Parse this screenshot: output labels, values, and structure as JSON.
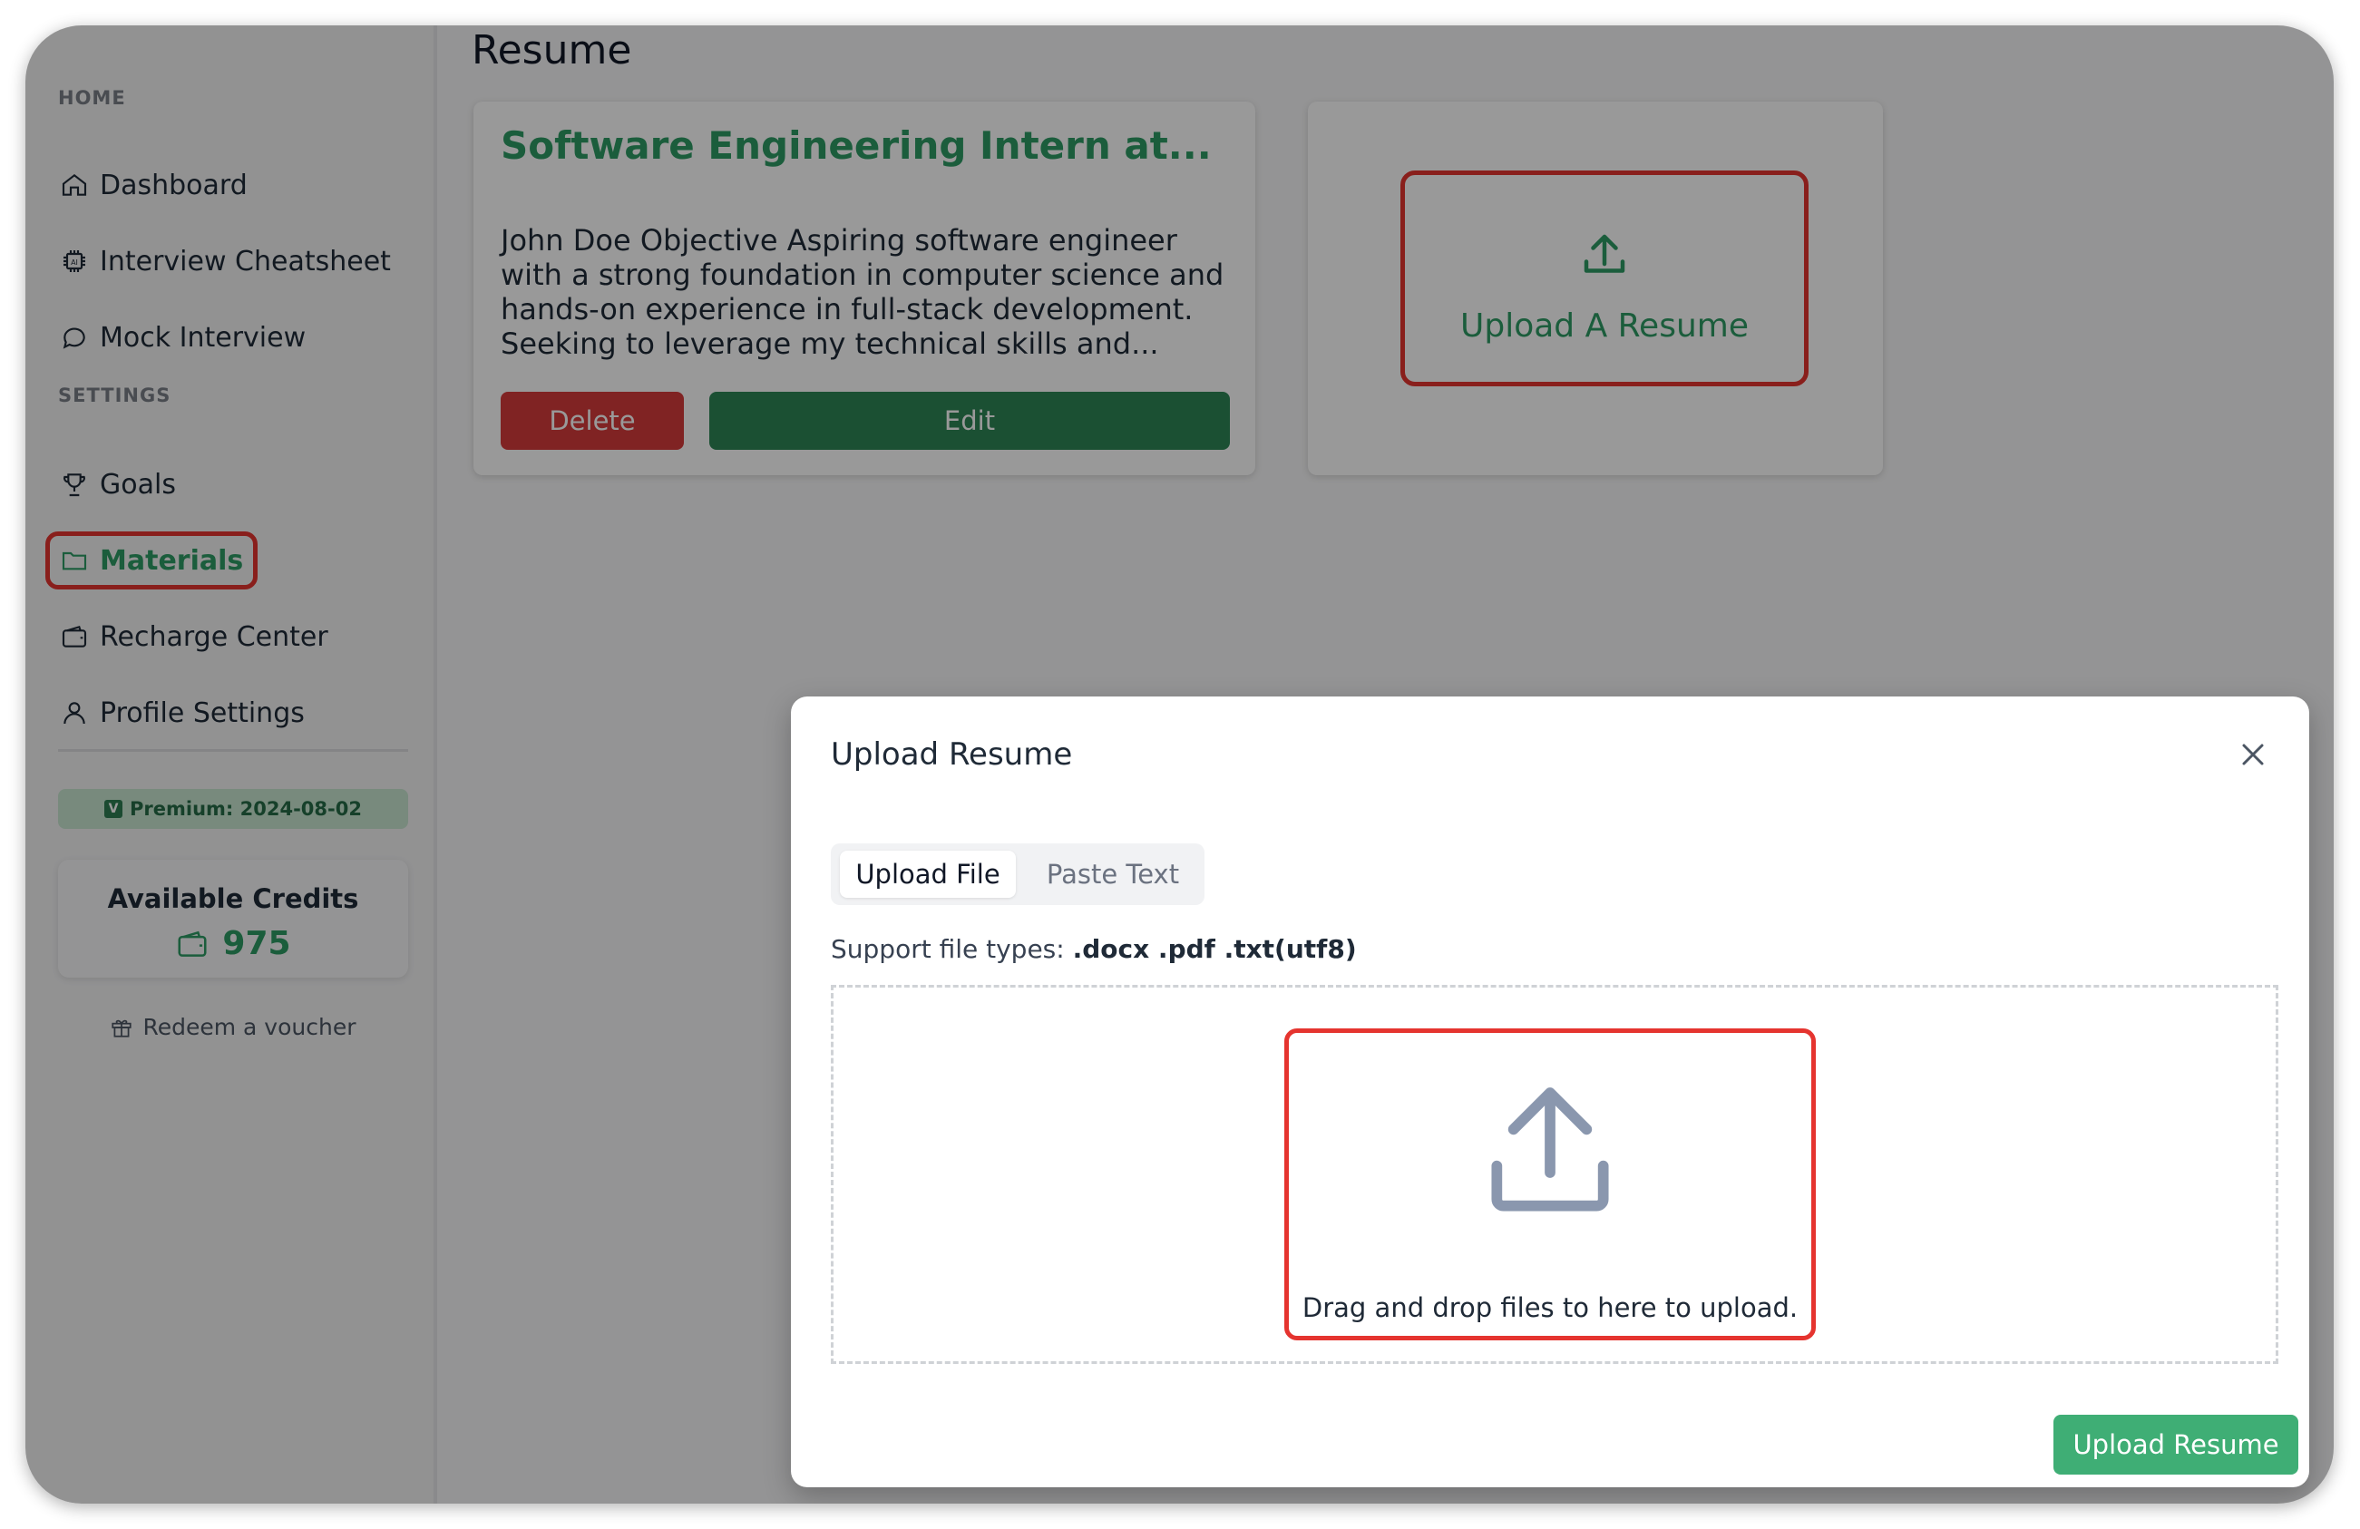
{
  "sidebar": {
    "home_label": "HOME",
    "settings_label": "SETTINGS",
    "items": [
      {
        "label": "Dashboard",
        "icon": "home-icon"
      },
      {
        "label": "Interview Cheatsheet",
        "icon": "ai-chip-icon"
      },
      {
        "label": "Mock Interview",
        "icon": "chat-bubble-icon"
      },
      {
        "label": "Goals",
        "icon": "trophy-icon"
      },
      {
        "label": "Materials",
        "icon": "folder-icon",
        "active": true
      },
      {
        "label": "Recharge Center",
        "icon": "wallet-icon"
      },
      {
        "label": "Profile Settings",
        "icon": "user-icon"
      }
    ],
    "premium_badge": "Premium: 2024-08-02",
    "premium_badge_letter": "V",
    "credits_title": "Available Credits",
    "credits_value": "975",
    "redeem_label": "Redeem a voucher"
  },
  "main": {
    "page_title": "Resume",
    "resume_card": {
      "title": "Software Engineering Intern at...",
      "snippet": "John Doe Objective Aspiring software engineer with a strong foundation in computer science and hands-on experience in full-stack development. Seeking to leverage my technical skills and...",
      "delete_label": "Delete",
      "edit_label": "Edit"
    },
    "upload_card": {
      "label": "Upload A Resume"
    }
  },
  "modal": {
    "title": "Upload Resume",
    "tabs": [
      {
        "label": "Upload File",
        "selected": true
      },
      {
        "label": "Paste Text",
        "selected": false
      }
    ],
    "support_prefix": "Support file types:",
    "support_types": ".docx .pdf .txt(utf8)",
    "drop_text": "Drag and drop files to here to upload.",
    "submit_label": "Upload Resume"
  },
  "colors": {
    "accent_green": "#2e9c64",
    "delete_red": "#d63b3b",
    "edit_green": "#2e8556",
    "submit_green": "#3fae75",
    "highlight_red": "#e5342f"
  }
}
